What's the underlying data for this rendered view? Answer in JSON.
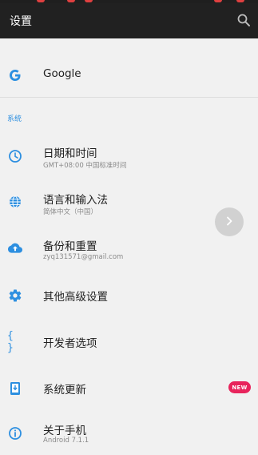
{
  "appbar": {
    "title": "设置",
    "search_icon": "search-icon"
  },
  "colors": {
    "appbar_bg": "#212121",
    "accent": "#2d8fe0",
    "badge": "#e8245c",
    "page_bg": "#f1f1f1"
  },
  "google": {
    "label": "Google",
    "icon": "google-g-icon"
  },
  "section": {
    "label": "系统"
  },
  "items": [
    {
      "title": "日期和时间",
      "subtitle": "GMT+08:00 中国标准时间",
      "icon": "clock-icon"
    },
    {
      "title": "语言和输入法",
      "subtitle": "简体中文（中国）",
      "icon": "globe-icon"
    },
    {
      "title": "备份和重置",
      "subtitle": "zyq131571@gmail.com",
      "icon": "cloud-upload-icon"
    },
    {
      "title": "其他高级设置",
      "subtitle": "",
      "icon": "gear-icon"
    },
    {
      "title": "开发者选项",
      "subtitle": "",
      "icon": "braces-icon"
    },
    {
      "title": "系统更新",
      "subtitle": "",
      "icon": "system-update-icon",
      "badge": "NEW"
    },
    {
      "title": "关于手机",
      "subtitle": "Android 7.1.1",
      "icon": "info-icon"
    }
  ]
}
